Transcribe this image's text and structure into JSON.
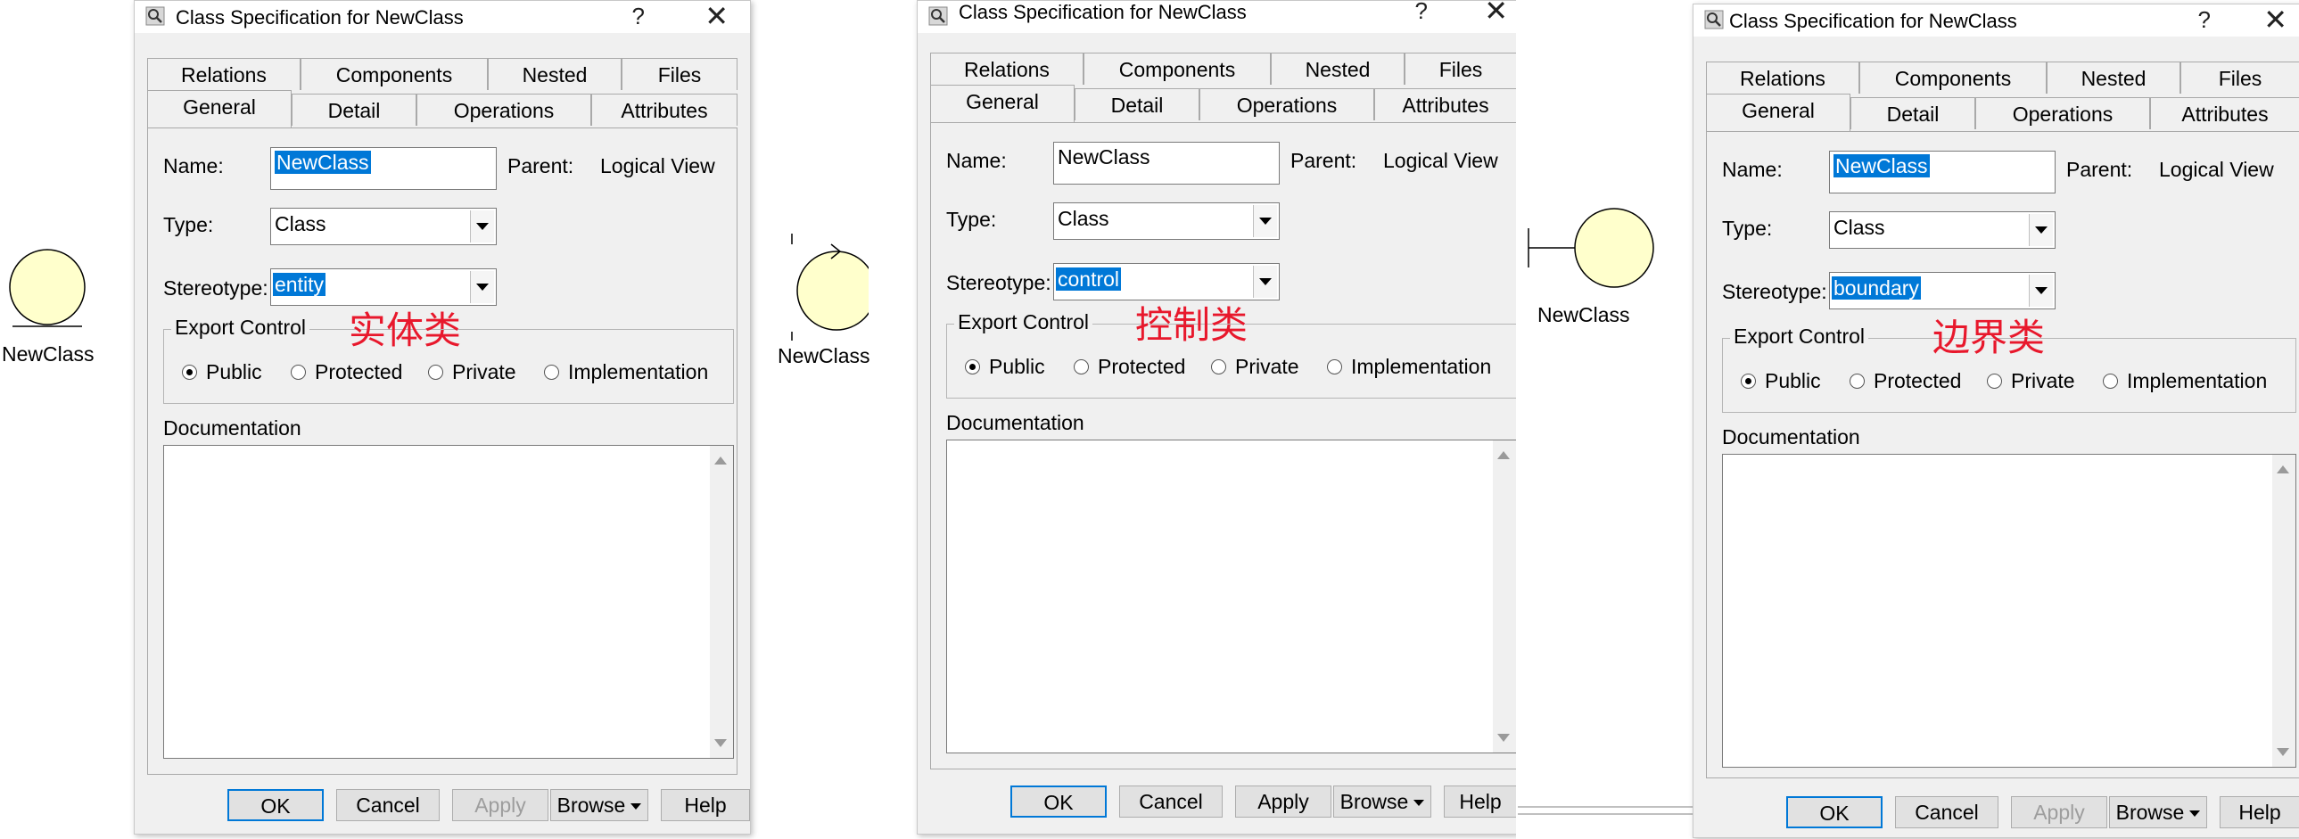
{
  "dialogs": [
    {
      "title": "Class Specification for NewClass",
      "help": "?",
      "close": "✕",
      "tabs_back": [
        "Relations",
        "Components",
        "Nested",
        "Files"
      ],
      "tabs_front": [
        "General",
        "Detail",
        "Operations",
        "Attributes"
      ],
      "name_label": "Name:",
      "name_value": "NewClass",
      "parent_label": "Parent:",
      "parent_value": "Logical View",
      "type_label": "Type:",
      "type_value": "Class",
      "stereotype_label": "Stereotype:",
      "stereotype_value": "entity",
      "export_label": "Export Control",
      "annotation": "实体类",
      "radios": [
        "Public",
        "Protected",
        "Private",
        "Implementation"
      ],
      "selected_radio": "Public",
      "documentation_label": "Documentation",
      "buttons": [
        "OK",
        "Cancel",
        "Apply",
        "Browse",
        "Help"
      ],
      "diagram_label": "NewClass"
    },
    {
      "title": "Class Specification for NewClass",
      "help": "?",
      "close": "✕",
      "tabs_back": [
        "Relations",
        "Components",
        "Nested",
        "Files"
      ],
      "tabs_front": [
        "General",
        "Detail",
        "Operations",
        "Attributes"
      ],
      "name_label": "Name:",
      "name_value": "NewClass",
      "parent_label": "Parent:",
      "parent_value": "Logical View",
      "type_label": "Type:",
      "type_value": "Class",
      "stereotype_label": "Stereotype:",
      "stereotype_value": "control",
      "export_label": "Export Control",
      "annotation": "控制类",
      "radios": [
        "Public",
        "Protected",
        "Private",
        "Implementation"
      ],
      "selected_radio": "Public",
      "documentation_label": "Documentation",
      "buttons": [
        "OK",
        "Cancel",
        "Apply",
        "Browse",
        "Help"
      ],
      "diagram_label": "NewClass"
    },
    {
      "title": "Class Specification for NewClass",
      "help": "?",
      "close": "✕",
      "tabs_back": [
        "Relations",
        "Components",
        "Nested",
        "Files"
      ],
      "tabs_front": [
        "General",
        "Detail",
        "Operations",
        "Attributes"
      ],
      "name_label": "Name:",
      "name_value": "NewClass",
      "parent_label": "Parent:",
      "parent_value": "Logical View",
      "type_label": "Type:",
      "type_value": "Class",
      "stereotype_label": "Stereotype:",
      "stereotype_value": "boundary",
      "export_label": "Export Control",
      "annotation": "边界类",
      "radios": [
        "Public",
        "Protected",
        "Private",
        "Implementation"
      ],
      "selected_radio": "Public",
      "documentation_label": "Documentation",
      "buttons": [
        "OK",
        "Cancel",
        "Apply",
        "Browse",
        "Help"
      ],
      "diagram_label": "NewClass"
    }
  ],
  "colors": {
    "selection": "#0078d7",
    "annotation": "#e8182c",
    "class_fill": "#ffffcc"
  }
}
